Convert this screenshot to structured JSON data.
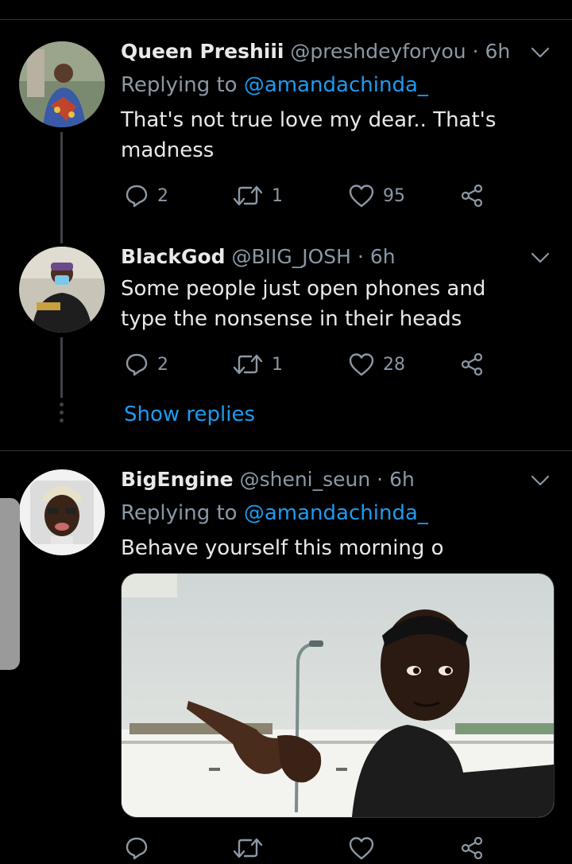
{
  "tweets": [
    {
      "name": "Queen Preshiii",
      "handle": "@preshdeyforyou",
      "time": "· 6h",
      "replying_prefix": "Replying to",
      "replying_to": "@amandachinda_",
      "text": "That's not true love my dear.. That's madness",
      "replies": "2",
      "retweets": "1",
      "likes": "95"
    },
    {
      "name": "BlackGod",
      "handle": "@BIIG_JOSH",
      "time": "· 6h",
      "text": "Some people just open phones and type the nonsense in their heads",
      "replies": "2",
      "retweets": "1",
      "likes": "28"
    },
    {
      "name": "BigEngine",
      "handle": "@sheni_seun",
      "time": "· 6h",
      "replying_prefix": "Replying to",
      "replying_to": "@amandachinda_",
      "text": "Behave yourself this morning o"
    }
  ],
  "show_replies": "Show replies",
  "colors": {
    "background": "#000000",
    "link": "#1d9bf0",
    "muted": "#8b98a5",
    "text": "#e7e9ea"
  },
  "icons": [
    "reply-icon",
    "retweet-icon",
    "like-icon",
    "share-icon",
    "chevron-down-icon"
  ]
}
